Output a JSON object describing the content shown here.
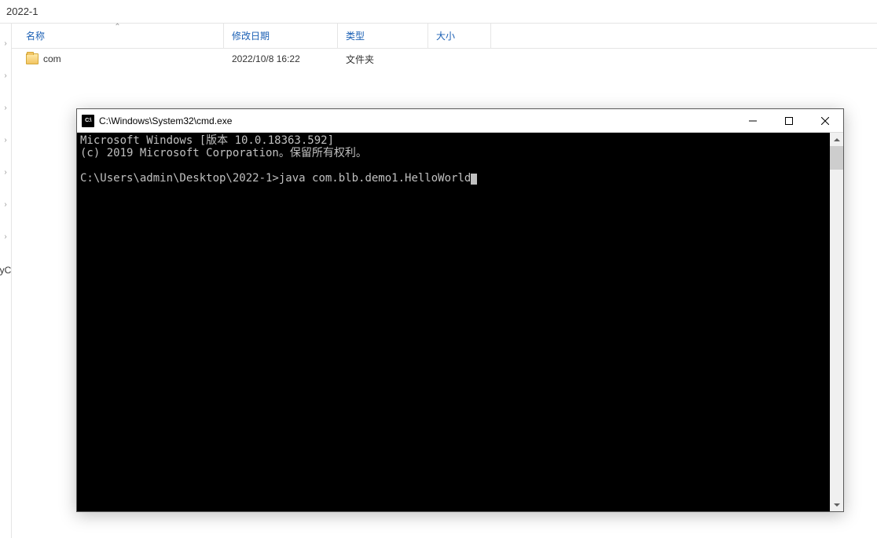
{
  "explorer": {
    "path": "2022-1",
    "columns": {
      "name": "名称",
      "date": "修改日期",
      "type": "类型",
      "size": "大小"
    },
    "rows": [
      {
        "name": "com",
        "date": "2022/10/8 16:22",
        "type": "文件夹",
        "size": ""
      }
    ],
    "sidebar_fragment": "yC"
  },
  "cmd": {
    "title": "C:\\Windows\\System32\\cmd.exe",
    "icon_text": "C:\\",
    "lines": {
      "l1": "Microsoft Windows [版本 10.0.18363.592]",
      "l2": "(c) 2019 Microsoft Corporation。保留所有权利。",
      "l3": "",
      "l4_prompt": "C:\\Users\\admin\\Desktop\\2022-1>",
      "l4_cmd": "java com.blb.demo1.HelloWorld"
    }
  }
}
